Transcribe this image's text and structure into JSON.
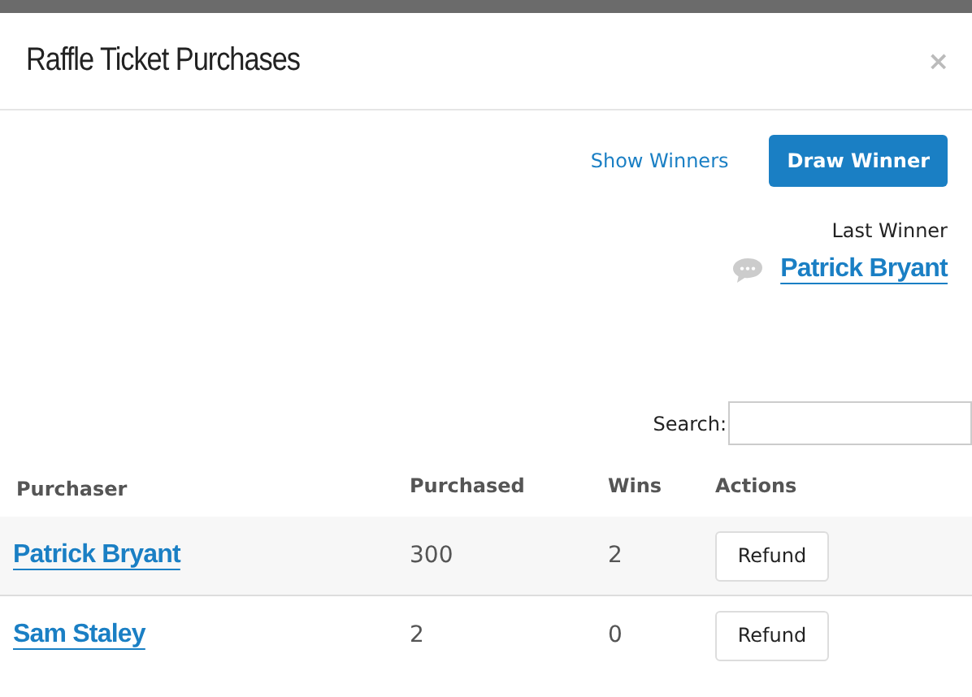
{
  "dialog": {
    "title": "Raffle Ticket Purchases",
    "close": "×"
  },
  "actions": {
    "show_winners": "Show Winners",
    "draw_winner": "Draw Winner"
  },
  "last_winner": {
    "label": "Last Winner",
    "name": "Patrick Bryant"
  },
  "search": {
    "label": "Search:"
  },
  "table": {
    "columns": [
      "Purchaser",
      "Purchased",
      "Wins",
      "Actions"
    ],
    "rows": [
      {
        "purchaser": "Patrick Bryant",
        "purchased": "300",
        "wins": "2",
        "action": "Refund"
      },
      {
        "purchaser": "Sam Staley",
        "purchased": "2",
        "wins": "0",
        "action": "Refund"
      }
    ]
  }
}
